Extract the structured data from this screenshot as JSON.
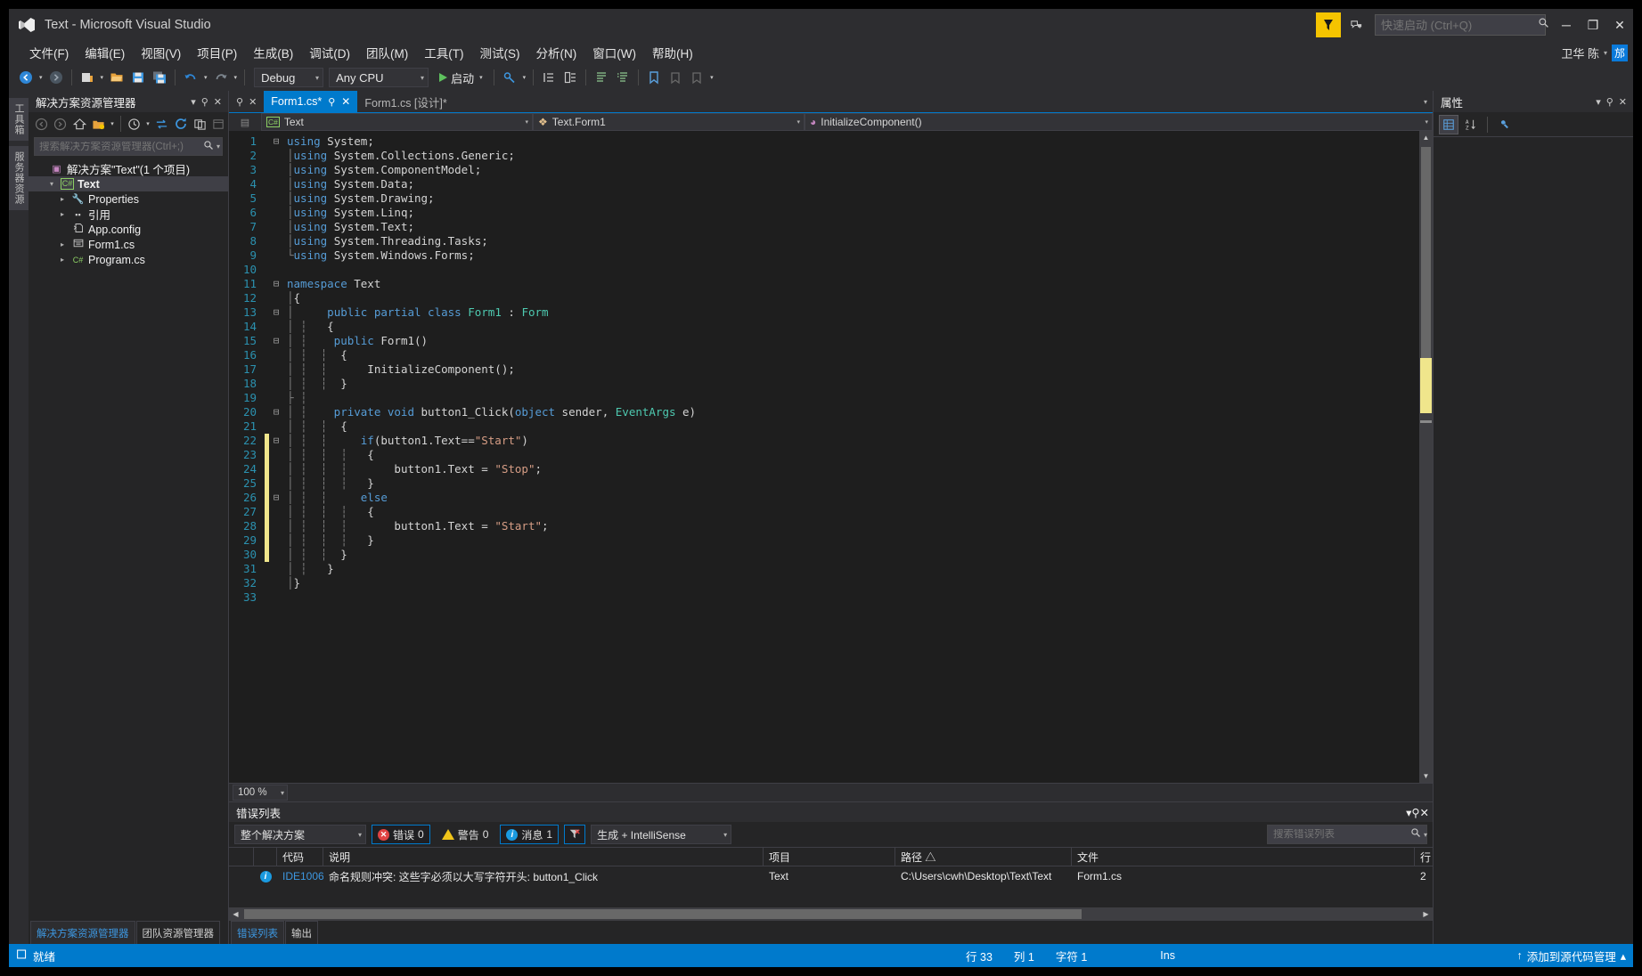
{
  "window": {
    "title": "Text - Microsoft Visual Studio",
    "logo_icon": "visual-studio-logo",
    "minimize_label": "─",
    "maximize_label": "❐",
    "close_label": "✕"
  },
  "quick_launch": {
    "placeholder": "快速启动 (Ctrl+Q)",
    "value": "",
    "search_icon": "search-icon"
  },
  "feedback": {
    "icon": "feedback-flag-icon"
  },
  "notify": {
    "icon": "notification-icon"
  },
  "account": {
    "name": "卫华 陈",
    "badge": "邡",
    "caret": "▾"
  },
  "menubar": {
    "items": [
      {
        "label": "文件(F)"
      },
      {
        "label": "编辑(E)"
      },
      {
        "label": "视图(V)"
      },
      {
        "label": "项目(P)"
      },
      {
        "label": "生成(B)"
      },
      {
        "label": "调试(D)"
      },
      {
        "label": "团队(M)"
      },
      {
        "label": "工具(T)"
      },
      {
        "label": "测试(S)"
      },
      {
        "label": "分析(N)"
      },
      {
        "label": "窗口(W)"
      },
      {
        "label": "帮助(H)"
      }
    ]
  },
  "toolbar": {
    "back_icon": "navigate-back-icon",
    "forward_icon": "navigate-forward-icon",
    "new_project_icon": "new-project-icon",
    "open_icon": "open-file-icon",
    "save_icon": "save-icon",
    "save_all_icon": "save-all-icon",
    "undo_icon": "undo-icon",
    "redo_icon": "redo-icon",
    "config": "Debug",
    "platform": "Any CPU",
    "start_label": "启动",
    "start_icon": "play-icon",
    "attach_icon": "attach-process-icon",
    "step_icons": [
      "step-into-icon",
      "step-over-icon",
      "comment-icon",
      "uncomment-icon"
    ],
    "bookmark_icon": "bookmark-icon",
    "outdent_icon": "outdent-icon",
    "indent_icon": "indent-icon"
  },
  "left_rail": {
    "tabs": [
      {
        "label": "工具箱"
      },
      {
        "label": "服务器资源"
      }
    ]
  },
  "solution_explorer": {
    "title": "解决方案资源管理器",
    "search_placeholder": "搜索解决方案资源管理器(Ctrl+;)",
    "search_value": "",
    "toolbar_icons": [
      "back-icon",
      "forward-icon",
      "home-icon",
      "show-all-files-icon",
      "pending-changes-icon",
      "sync-icon",
      "refresh-icon",
      "collapse-all-icon",
      "properties-icon"
    ],
    "tree": [
      {
        "indent": 0,
        "arrow": "",
        "icon": "solution-icon",
        "icon_glyph": "▣",
        "icon_color": "#c586c0",
        "label": "解决方案\"Text\"(1 个项目)",
        "bold": false,
        "selected": false
      },
      {
        "indent": 1,
        "arrow": "▾",
        "icon": "csharp-project-icon",
        "icon_glyph": "C#",
        "icon_color": "#8ccf64",
        "label": "Text",
        "bold": true,
        "selected": true
      },
      {
        "indent": 2,
        "arrow": "▸",
        "icon": "properties-folder-icon",
        "icon_glyph": "⚒",
        "icon_color": "#c8c8c8",
        "label": "Properties",
        "bold": false,
        "selected": false
      },
      {
        "indent": 2,
        "arrow": "▸",
        "icon": "references-icon",
        "icon_glyph": "▪▪",
        "icon_color": "#c8c8c8",
        "label": "引用",
        "bold": false,
        "selected": false
      },
      {
        "indent": 2,
        "arrow": "",
        "icon": "config-file-icon",
        "icon_glyph": "⚒",
        "icon_color": "#c8c8c8",
        "label": "App.config",
        "bold": false,
        "selected": false
      },
      {
        "indent": 2,
        "arrow": "▸",
        "icon": "form-file-icon",
        "icon_glyph": "▤",
        "icon_color": "#c8c8c8",
        "label": "Form1.cs",
        "bold": false,
        "selected": false
      },
      {
        "indent": 2,
        "arrow": "▸",
        "icon": "csharp-file-icon",
        "icon_glyph": "C#",
        "icon_color": "#8ccf64",
        "label": "Program.cs",
        "bold": false,
        "selected": false
      }
    ],
    "bottom_tabs": [
      {
        "label": "解决方案资源管理器",
        "active": true
      },
      {
        "label": "团队资源管理器",
        "active": false
      }
    ]
  },
  "editor": {
    "tabs": [
      {
        "label": "Form1.cs*",
        "active": true,
        "closable": true,
        "pinnable": true
      },
      {
        "label": "Form1.cs [设计]*",
        "active": false,
        "closable": false,
        "pinnable": false
      }
    ],
    "navbar": {
      "project": "Text",
      "project_icon": "csharp-icon",
      "type": "Text.Form1",
      "type_icon": "class-icon",
      "member": "InitializeComponent()",
      "member_icon": "method-icon"
    },
    "zoom": "100 %",
    "code_lines": [
      {
        "n": 1,
        "fold": "⊟",
        "changed": false,
        "tokens": [
          {
            "c": "k",
            "t": "using"
          },
          {
            "c": "p",
            "t": " System;"
          }
        ]
      },
      {
        "n": 2,
        "fold": "",
        "changed": false,
        "tokens": [
          {
            "c": "sq",
            "t": "│"
          },
          {
            "c": "k",
            "t": "using"
          },
          {
            "c": "p",
            "t": " System.Collections.Generic;"
          }
        ]
      },
      {
        "n": 3,
        "fold": "",
        "changed": false,
        "tokens": [
          {
            "c": "sq",
            "t": "│"
          },
          {
            "c": "k",
            "t": "using"
          },
          {
            "c": "p",
            "t": " System.ComponentModel;"
          }
        ]
      },
      {
        "n": 4,
        "fold": "",
        "changed": false,
        "tokens": [
          {
            "c": "sq",
            "t": "│"
          },
          {
            "c": "k",
            "t": "using"
          },
          {
            "c": "p",
            "t": " System.Data;"
          }
        ]
      },
      {
        "n": 5,
        "fold": "",
        "changed": false,
        "tokens": [
          {
            "c": "sq",
            "t": "│"
          },
          {
            "c": "k",
            "t": "using"
          },
          {
            "c": "p",
            "t": " System.Drawing;"
          }
        ]
      },
      {
        "n": 6,
        "fold": "",
        "changed": false,
        "tokens": [
          {
            "c": "sq",
            "t": "│"
          },
          {
            "c": "k",
            "t": "using"
          },
          {
            "c": "p",
            "t": " System.Linq;"
          }
        ]
      },
      {
        "n": 7,
        "fold": "",
        "changed": false,
        "tokens": [
          {
            "c": "sq",
            "t": "│"
          },
          {
            "c": "k",
            "t": "using"
          },
          {
            "c": "p",
            "t": " System.Text;"
          }
        ]
      },
      {
        "n": 8,
        "fold": "",
        "changed": false,
        "tokens": [
          {
            "c": "sq",
            "t": "│"
          },
          {
            "c": "k",
            "t": "using"
          },
          {
            "c": "p",
            "t": " System.Threading.Tasks;"
          }
        ]
      },
      {
        "n": 9,
        "fold": "",
        "changed": false,
        "tokens": [
          {
            "c": "sq",
            "t": "└"
          },
          {
            "c": "k",
            "t": "using"
          },
          {
            "c": "p",
            "t": " System.Windows.Forms;"
          }
        ]
      },
      {
        "n": 10,
        "fold": "",
        "changed": false,
        "tokens": []
      },
      {
        "n": 11,
        "fold": "⊟",
        "changed": false,
        "tokens": [
          {
            "c": "k",
            "t": "namespace"
          },
          {
            "c": "p",
            "t": " Text"
          }
        ]
      },
      {
        "n": 12,
        "fold": "",
        "changed": false,
        "tokens": [
          {
            "c": "sq",
            "t": "│"
          },
          {
            "c": "p",
            "t": "{"
          }
        ]
      },
      {
        "n": 13,
        "fold": "⊟",
        "changed": false,
        "tokens": [
          {
            "c": "sq",
            "t": "│ "
          },
          {
            "c": "k",
            "t": "    public partial class "
          },
          {
            "c": "t",
            "t": "Form1"
          },
          {
            "c": "p",
            "t": " : "
          },
          {
            "c": "t",
            "t": "Form"
          }
        ]
      },
      {
        "n": 14,
        "fold": "",
        "changed": false,
        "tokens": [
          {
            "c": "sq",
            "t": "│ ┆"
          },
          {
            "c": "p",
            "t": "   {"
          }
        ]
      },
      {
        "n": 15,
        "fold": "⊟",
        "changed": false,
        "tokens": [
          {
            "c": "sq",
            "t": "│ ┆"
          },
          {
            "c": "k",
            "t": "    public "
          },
          {
            "c": "p",
            "t": "Form1()"
          }
        ]
      },
      {
        "n": 16,
        "fold": "",
        "changed": false,
        "tokens": [
          {
            "c": "sq",
            "t": "│ ┆  ┆"
          },
          {
            "c": "p",
            "t": "  {"
          }
        ]
      },
      {
        "n": 17,
        "fold": "",
        "changed": false,
        "tokens": [
          {
            "c": "sq",
            "t": "│ ┆  ┆"
          },
          {
            "c": "p",
            "t": "      InitializeComponent();"
          }
        ]
      },
      {
        "n": 18,
        "fold": "",
        "changed": false,
        "tokens": [
          {
            "c": "sq",
            "t": "│ ┆  ┆"
          },
          {
            "c": "p",
            "t": "  }"
          }
        ]
      },
      {
        "n": 19,
        "fold": "",
        "changed": false,
        "tokens": [
          {
            "c": "sq",
            "t": "├ ┆"
          }
        ]
      },
      {
        "n": 20,
        "fold": "⊟",
        "changed": false,
        "tokens": [
          {
            "c": "sq",
            "t": "│ ┆"
          },
          {
            "c": "k",
            "t": "    private void "
          },
          {
            "c": "p",
            "t": "button1_Click("
          },
          {
            "c": "k",
            "t": "object"
          },
          {
            "c": "p",
            "t": " sender, "
          },
          {
            "c": "t",
            "t": "EventArgs"
          },
          {
            "c": "p",
            "t": " e)"
          }
        ]
      },
      {
        "n": 21,
        "fold": "",
        "changed": false,
        "tokens": [
          {
            "c": "sq",
            "t": "│ ┆  ┆"
          },
          {
            "c": "p",
            "t": "  {"
          }
        ]
      },
      {
        "n": 22,
        "fold": "⊟",
        "changed": true,
        "tokens": [
          {
            "c": "sq",
            "t": "│ ┆  ┆"
          },
          {
            "c": "k",
            "t": "     if"
          },
          {
            "c": "p",
            "t": "(button1.Text=="
          },
          {
            "c": "s",
            "t": "\"Start\""
          },
          {
            "c": "p",
            "t": ")"
          }
        ]
      },
      {
        "n": 23,
        "fold": "",
        "changed": true,
        "tokens": [
          {
            "c": "sq",
            "t": "│ ┆  ┆  ┆"
          },
          {
            "c": "p",
            "t": "   {"
          }
        ]
      },
      {
        "n": 24,
        "fold": "",
        "changed": true,
        "tokens": [
          {
            "c": "sq",
            "t": "│ ┆  ┆  ┆"
          },
          {
            "c": "p",
            "t": "       button1.Text = "
          },
          {
            "c": "s",
            "t": "\"Stop\""
          },
          {
            "c": "p",
            "t": ";"
          }
        ]
      },
      {
        "n": 25,
        "fold": "",
        "changed": true,
        "tokens": [
          {
            "c": "sq",
            "t": "│ ┆  ┆  ┆"
          },
          {
            "c": "p",
            "t": "   }"
          }
        ]
      },
      {
        "n": 26,
        "fold": "⊟",
        "changed": true,
        "tokens": [
          {
            "c": "sq",
            "t": "│ ┆  ┆"
          },
          {
            "c": "k",
            "t": "     else"
          }
        ]
      },
      {
        "n": 27,
        "fold": "",
        "changed": true,
        "tokens": [
          {
            "c": "sq",
            "t": "│ ┆  ┆  ┆"
          },
          {
            "c": "p",
            "t": "   {"
          }
        ]
      },
      {
        "n": 28,
        "fold": "",
        "changed": true,
        "tokens": [
          {
            "c": "sq",
            "t": "│ ┆  ┆  ┆"
          },
          {
            "c": "p",
            "t": "       button1.Text = "
          },
          {
            "c": "s",
            "t": "\"Start\""
          },
          {
            "c": "p",
            "t": ";"
          }
        ]
      },
      {
        "n": 29,
        "fold": "",
        "changed": true,
        "tokens": [
          {
            "c": "sq",
            "t": "│ ┆  ┆  ┆"
          },
          {
            "c": "p",
            "t": "   }"
          }
        ]
      },
      {
        "n": 30,
        "fold": "",
        "changed": true,
        "tokens": [
          {
            "c": "sq",
            "t": "│ ┆  ┆"
          },
          {
            "c": "p",
            "t": "  }"
          }
        ]
      },
      {
        "n": 31,
        "fold": "",
        "changed": false,
        "tokens": [
          {
            "c": "sq",
            "t": "│ ┆"
          },
          {
            "c": "p",
            "t": "   }"
          }
        ]
      },
      {
        "n": 32,
        "fold": "",
        "changed": false,
        "tokens": [
          {
            "c": "sq",
            "t": "│"
          },
          {
            "c": "p",
            "t": "}"
          }
        ]
      },
      {
        "n": 33,
        "fold": "",
        "changed": false,
        "tokens": []
      }
    ]
  },
  "error_list": {
    "title": "错误列表",
    "scope": "整个解决方案",
    "errors_label": "错误",
    "errors_count": "0",
    "warnings_label": "警告",
    "warnings_count": "0",
    "messages_label": "消息",
    "messages_count": "1",
    "filter_icon": "clear-filter-icon",
    "build_source": "生成 + IntelliSense",
    "search_placeholder": "搜索错误列表",
    "search_value": "",
    "columns": [
      "",
      "",
      "代码",
      "说明",
      "项目",
      "路径 △",
      "文件",
      "行"
    ],
    "rows": [
      {
        "severity_icon": "info-icon",
        "code": "IDE1006",
        "description": "命名规则冲突: 这些字必须以大写字符开头: button1_Click",
        "project": "Text",
        "path": "C:\\Users\\cwh\\Desktop\\Text\\Text",
        "file": "Form1.cs",
        "line": "2"
      }
    ],
    "tabs": [
      {
        "label": "错误列表",
        "active": true
      },
      {
        "label": "输出",
        "active": false
      }
    ]
  },
  "properties_panel": {
    "title": "属性",
    "toolbar_icons": [
      "categorized-icon",
      "alphabetical-icon",
      "properties-page-icon"
    ]
  },
  "statusbar": {
    "ready_icon": "ready-icon",
    "ready": "就绪",
    "line_label": "行 33",
    "col_label": "列 1",
    "char_label": "字符 1",
    "insert_mode": "Ins",
    "source_control": "添加到源代码管理",
    "source_control_icon": "upload-arrow-icon",
    "source_control_caret": "▴"
  },
  "colors": {
    "accent": "#007acc",
    "feedback": "#f5c400",
    "error": "#e04343",
    "warning": "#f0c419",
    "info": "#1a9ae0",
    "changed_bar": "#f0e68c"
  }
}
